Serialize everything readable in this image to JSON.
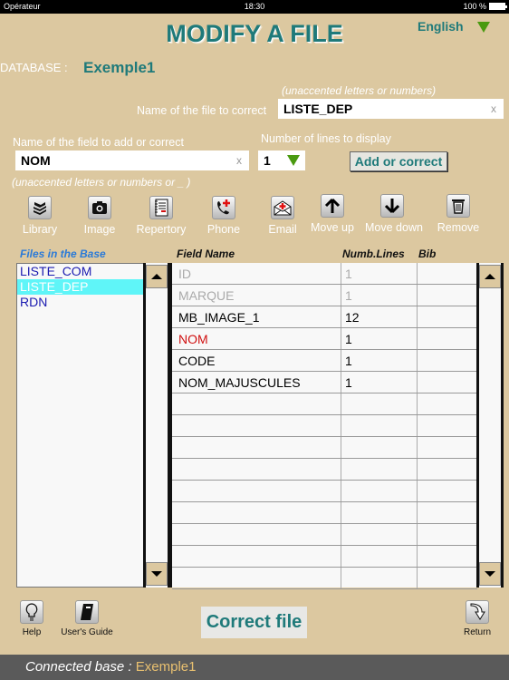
{
  "status_bar": {
    "carrier": "Opérateur",
    "time": "18:30",
    "battery": "100 %"
  },
  "header": {
    "title": "MODIFY A FILE",
    "language": "English"
  },
  "database": {
    "label": "DATABASE :",
    "value": "Exemple1"
  },
  "file_name": {
    "hint": "(unaccented letters or numbers)",
    "label": "Name of the file to correct",
    "value": "LISTE_DEP",
    "clear": "x"
  },
  "field_name": {
    "label": "Name of the field to add or correct",
    "value": "NOM",
    "clear": "x",
    "hint": "(unaccented letters or numbers or _ )"
  },
  "lines": {
    "label": "Number of lines to display",
    "value": "1"
  },
  "add_button": "Add or correct",
  "toolbar": [
    {
      "icon": "library-icon",
      "label": "Library"
    },
    {
      "icon": "camera-icon",
      "label": "Image"
    },
    {
      "icon": "repertory-icon",
      "label": "Repertory"
    },
    {
      "icon": "phone-icon",
      "label": "Phone"
    },
    {
      "icon": "email-icon",
      "label": "Email"
    },
    {
      "icon": "arrow-up-icon",
      "label": "Move up"
    },
    {
      "icon": "arrow-down-icon",
      "label": "Move down"
    },
    {
      "icon": "trash-icon",
      "label": "Remove"
    }
  ],
  "columns": {
    "files": "Files in the Base",
    "field_name": "Field Name",
    "lines": "Numb.Lines",
    "bib": "Bib"
  },
  "files": [
    {
      "name": "LISTE_COM",
      "selected": false
    },
    {
      "name": "LISTE_DEP",
      "selected": true
    },
    {
      "name": "RDN",
      "selected": false
    }
  ],
  "fields": [
    {
      "name": "ID",
      "lines": "1",
      "bib": "",
      "state": "dim"
    },
    {
      "name": "MARQUE",
      "lines": "1",
      "bib": "",
      "state": "dim"
    },
    {
      "name": "MB_IMAGE_1",
      "lines": "12",
      "bib": "",
      "state": "normal"
    },
    {
      "name": "NOM",
      "lines": "1",
      "bib": "",
      "state": "red"
    },
    {
      "name": "CODE",
      "lines": "1",
      "bib": "",
      "state": "normal"
    },
    {
      "name": "NOM_MAJUSCULES",
      "lines": "1",
      "bib": "",
      "state": "normal"
    }
  ],
  "bottom": {
    "help": "Help",
    "guide": "User's Guide",
    "correct": "Correct file",
    "return": "Return"
  },
  "footer": {
    "label": "Connected base :",
    "value": "Exemple1"
  },
  "colors": {
    "background": "#dcc8a0",
    "accent": "#1f7a7a",
    "selection": "#5ff5f8",
    "highlight_red": "#d01010"
  }
}
